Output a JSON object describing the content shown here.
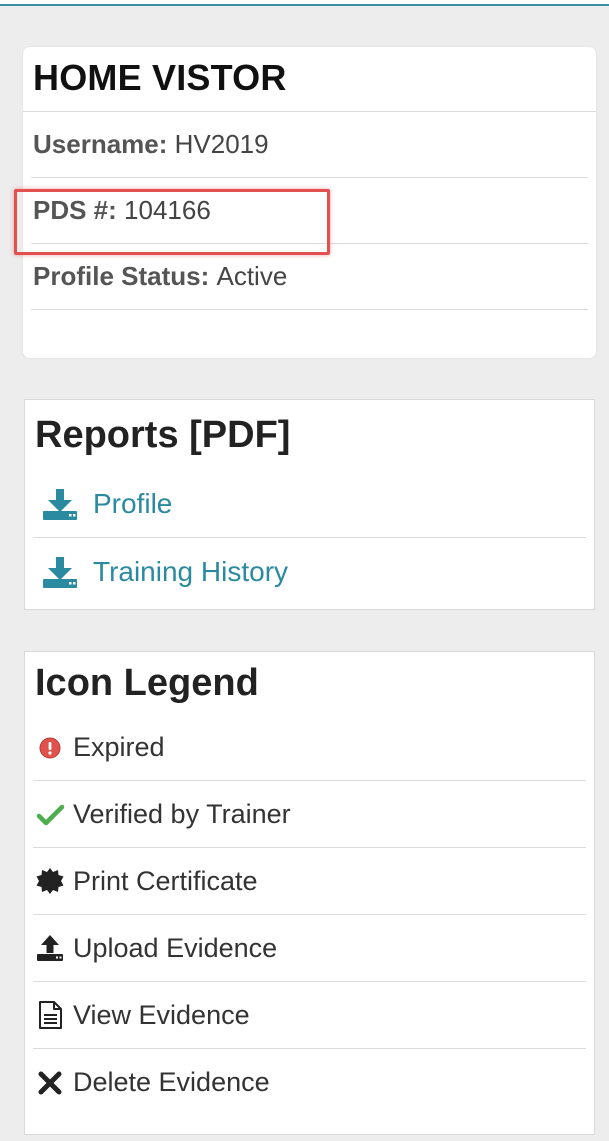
{
  "profile": {
    "title": "HOME VISTOR",
    "rows": [
      {
        "label": "Username:",
        "value": "HV2019"
      },
      {
        "label": "PDS #:",
        "value": "104166"
      },
      {
        "label": "Profile Status:",
        "value": "Active"
      }
    ]
  },
  "reports": {
    "title": "Reports [PDF]",
    "links": [
      {
        "label": "Profile",
        "icon": "download-icon"
      },
      {
        "label": "Training History",
        "icon": "download-icon"
      }
    ]
  },
  "legend": {
    "title": "Icon Legend",
    "items": [
      {
        "label": "Expired",
        "icon": "expired-icon"
      },
      {
        "label": "Verified by Trainer",
        "icon": "checkmark-icon"
      },
      {
        "label": "Print Certificate",
        "icon": "certificate-seal-icon"
      },
      {
        "label": "Upload Evidence",
        "icon": "upload-icon"
      },
      {
        "label": "View Evidence",
        "icon": "document-icon"
      },
      {
        "label": "Delete Evidence",
        "icon": "delete-x-icon"
      }
    ]
  },
  "colors": {
    "link": "#2a8aa0",
    "highlight": "#e2504f",
    "expired": "#e0524b",
    "verified": "#4cae4c"
  }
}
